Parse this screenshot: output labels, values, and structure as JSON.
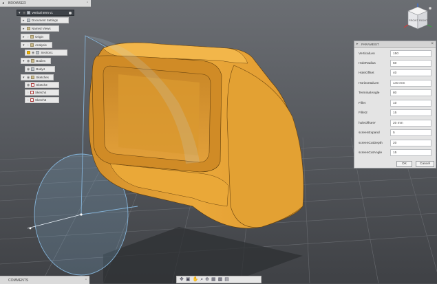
{
  "browser": {
    "title": "BROWSER",
    "items": [
      {
        "label": "vertical term v1",
        "type": "root"
      },
      {
        "label": "Document Settings",
        "type": "settings"
      },
      {
        "label": "Named Views",
        "type": "folder"
      },
      {
        "label": "Origin",
        "type": "folder"
      },
      {
        "label": "Analysis",
        "type": "folder"
      },
      {
        "label": "Section1",
        "type": "warn"
      },
      {
        "label": "Bodies",
        "type": "folder"
      },
      {
        "label": "Body4",
        "type": "body"
      },
      {
        "label": "Sketches",
        "type": "folder"
      },
      {
        "label": "Sketch3",
        "type": "sketch"
      },
      {
        "label": "Sketch4",
        "type": "sketch"
      },
      {
        "label": "Sketch5",
        "type": "sketch"
      }
    ]
  },
  "viewcube": {
    "face_front": "FRONT",
    "face_right": "RIGHT",
    "face_top": "TOP"
  },
  "parameters": {
    "title": "PARAMEIST",
    "rows": [
      {
        "name": "VerticalLen",
        "value": "150"
      },
      {
        "name": "HoleRadius",
        "value": "50"
      },
      {
        "name": "HoleOffset",
        "value": "40"
      },
      {
        "name": "HorizontalLen",
        "value": "140 mm"
      },
      {
        "name": "TerminalAngle",
        "value": "80"
      },
      {
        "name": "Fillet",
        "value": "10"
      },
      {
        "name": "Fillet2",
        "value": "15"
      },
      {
        "name": "holeOffsetY",
        "value": "20 mm"
      },
      {
        "name": "screenExpand",
        "value": "5"
      },
      {
        "name": "screenCutDepth",
        "value": "20"
      },
      {
        "name": "screenCutAngle",
        "value": "15"
      }
    ],
    "ok_label": "OK",
    "cancel_label": "Cancel"
  },
  "comments": {
    "title": "COMMENTS"
  },
  "colors": {
    "background": "#4a4c50",
    "grid": "#64676b",
    "body": "#e7a535",
    "body_shadow": "#b77a1e",
    "sketch_line": "#7fb0d8",
    "root_row": "#3d4248"
  },
  "navbar": {
    "icons": [
      "orbit-icon",
      "look-at-icon",
      "pan-icon",
      "zoom-icon",
      "fit-icon",
      "display-icon",
      "grid-icon",
      "viewport-icon"
    ]
  }
}
